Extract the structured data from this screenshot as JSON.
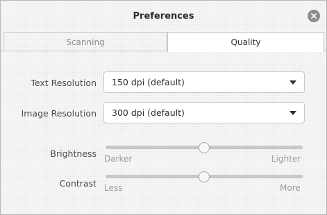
{
  "window": {
    "title": "Preferences"
  },
  "tabs": [
    {
      "label": "Scanning",
      "selected": false
    },
    {
      "label": "Quality",
      "selected": true
    }
  ],
  "text_resolution": {
    "label": "Text Resolution",
    "value": "150 dpi (default)"
  },
  "image_resolution": {
    "label": "Image Resolution",
    "value": "300 dpi (default)"
  },
  "brightness": {
    "label": "Brightness",
    "min_label": "Darker",
    "max_label": "Lighter",
    "value_fraction": 0.5
  },
  "contrast": {
    "label": "Contrast",
    "min_label": "Less",
    "max_label": "More",
    "value_fraction": 0.5
  }
}
